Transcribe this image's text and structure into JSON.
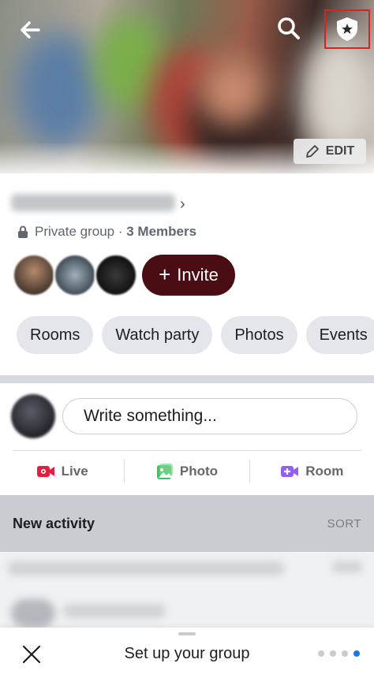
{
  "header": {
    "edit_label": "EDIT"
  },
  "group": {
    "privacy_label": "Private group · ",
    "member_count": "3 Members"
  },
  "invite": {
    "label": "Invite"
  },
  "chips": [
    "Rooms",
    "Watch party",
    "Photos",
    "Events"
  ],
  "composer": {
    "placeholder": "Write something..."
  },
  "actions": {
    "live": "Live",
    "photo": "Photo",
    "room": "Room"
  },
  "activity": {
    "title": "New activity",
    "sort": "SORT"
  },
  "sheet": {
    "title": "Set up your group",
    "dots_total": 4,
    "dots_active_index": 3
  },
  "colors": {
    "invite_bg": "#4b0d14",
    "live_red": "#e41e3f",
    "photo_green": "#45bd62",
    "room_purple": "#9360f7",
    "highlight_red": "#e0201f",
    "dot_active": "#1877f2"
  },
  "icons": {
    "back": "arrow-left-icon",
    "search": "search-icon",
    "admin": "shield-star-icon",
    "edit": "pencil-icon",
    "lock": "lock-icon",
    "live": "live-video-icon",
    "photo": "photo-icon",
    "room": "video-room-icon",
    "close": "close-icon"
  }
}
